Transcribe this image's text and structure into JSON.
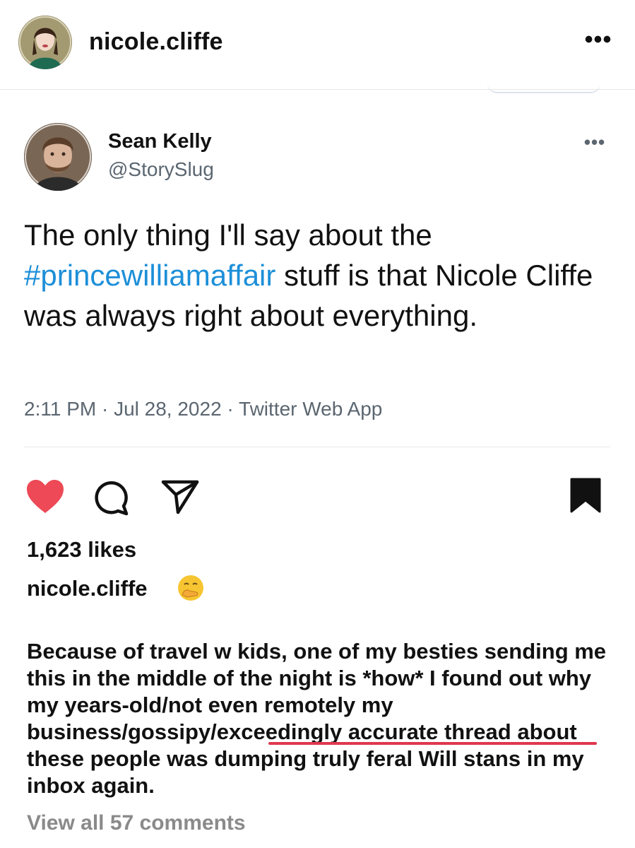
{
  "post": {
    "username": "nicole.cliffe",
    "more_label": "•••"
  },
  "tweet": {
    "author_name": "Sean Kelly",
    "handle": "@StorySlug",
    "more_label": "•••",
    "text_before": "The only thing I'll say about the ",
    "hashtag": "#princewilliamaffair",
    "text_after": " stuff is that Nicole Cliffe was always right about everything.",
    "meta": "2:11 PM · Jul 28, 2022 · Twitter Web App"
  },
  "actions": {
    "liked": true,
    "saved": true,
    "like_color": "#ed4956"
  },
  "likes_label": "1,623 likes",
  "caption": {
    "username": "nicole.cliffe",
    "emoji": "face-with-hand-over-mouth",
    "text": "Because of travel w kids, one of my besties sending me this in the middle of the night is *how* I found out why my years-old/not even remotely my business/gossipy/exceedingly accurate thread about these people was dumping truly feral Will stans in my inbox again.",
    "underline_color": "#e0384d"
  },
  "comments_link": "View all 57 comments",
  "colors": {
    "hashtag": "#1d8fd8",
    "secondary_text": "#5b6670",
    "muted_text": "#8a8a8a"
  }
}
